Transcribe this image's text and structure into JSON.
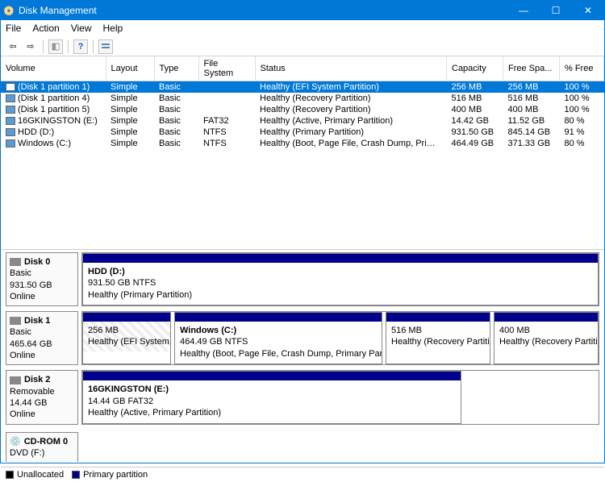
{
  "window": {
    "title": "Disk Management"
  },
  "menu": {
    "file": "File",
    "action": "Action",
    "view": "View",
    "help": "Help"
  },
  "columns": {
    "volume": "Volume",
    "layout": "Layout",
    "type": "Type",
    "filesystem": "File System",
    "status": "Status",
    "capacity": "Capacity",
    "freespace": "Free Spa...",
    "pctfree": "% Free"
  },
  "volumes": [
    {
      "name": "(Disk 1 partition 1)",
      "layout": "Simple",
      "type": "Basic",
      "fs": "",
      "status": "Healthy (EFI System Partition)",
      "capacity": "256 MB",
      "free": "256 MB",
      "pct": "100 %",
      "selected": true
    },
    {
      "name": "(Disk 1 partition 4)",
      "layout": "Simple",
      "type": "Basic",
      "fs": "",
      "status": "Healthy (Recovery Partition)",
      "capacity": "516 MB",
      "free": "516 MB",
      "pct": "100 %"
    },
    {
      "name": "(Disk 1 partition 5)",
      "layout": "Simple",
      "type": "Basic",
      "fs": "",
      "status": "Healthy (Recovery Partition)",
      "capacity": "400 MB",
      "free": "400 MB",
      "pct": "100 %"
    },
    {
      "name": "16GKINGSTON (E:)",
      "layout": "Simple",
      "type": "Basic",
      "fs": "FAT32",
      "status": "Healthy (Active, Primary Partition)",
      "capacity": "14.42 GB",
      "free": "11.52 GB",
      "pct": "80 %"
    },
    {
      "name": "HDD (D:)",
      "layout": "Simple",
      "type": "Basic",
      "fs": "NTFS",
      "status": "Healthy (Primary Partition)",
      "capacity": "931.50 GB",
      "free": "845.14 GB",
      "pct": "91 %"
    },
    {
      "name": "Windows (C:)",
      "layout": "Simple",
      "type": "Basic",
      "fs": "NTFS",
      "status": "Healthy (Boot, Page File, Crash Dump, Primary Partition)",
      "capacity": "464.49 GB",
      "free": "371.33 GB",
      "pct": "80 %"
    }
  ],
  "disks": {
    "d0": {
      "name": "Disk 0",
      "type": "Basic",
      "size": "931.50 GB",
      "state": "Online"
    },
    "d1": {
      "name": "Disk 1",
      "type": "Basic",
      "size": "465.64 GB",
      "state": "Online"
    },
    "d2": {
      "name": "Disk 2",
      "type": "Removable",
      "size": "14.44 GB",
      "state": "Online"
    },
    "cd": {
      "name": "CD-ROM 0",
      "type": "DVD (F:)"
    }
  },
  "parts": {
    "d0p1": {
      "title": "HDD  (D:)",
      "line2": "931.50 GB NTFS",
      "line3": "Healthy (Primary Partition)"
    },
    "d1p1": {
      "title": "",
      "line2": "256 MB",
      "line3": "Healthy (EFI System Partition)"
    },
    "d1p2": {
      "title": "Windows  (C:)",
      "line2": "464.49 GB NTFS",
      "line3": "Healthy (Boot, Page File, Crash Dump, Primary Partition)"
    },
    "d1p3": {
      "title": "",
      "line2": "516 MB",
      "line3": "Healthy (Recovery Partition)"
    },
    "d1p4": {
      "title": "",
      "line2": "400 MB",
      "line3": "Healthy (Recovery Partition)"
    },
    "d2p1": {
      "title": "16GKINGSTON  (E:)",
      "line2": "14.44 GB FAT32",
      "line3": "Healthy (Active, Primary Partition)"
    }
  },
  "legend": {
    "unallocated": "Unallocated",
    "primary": "Primary partition"
  }
}
